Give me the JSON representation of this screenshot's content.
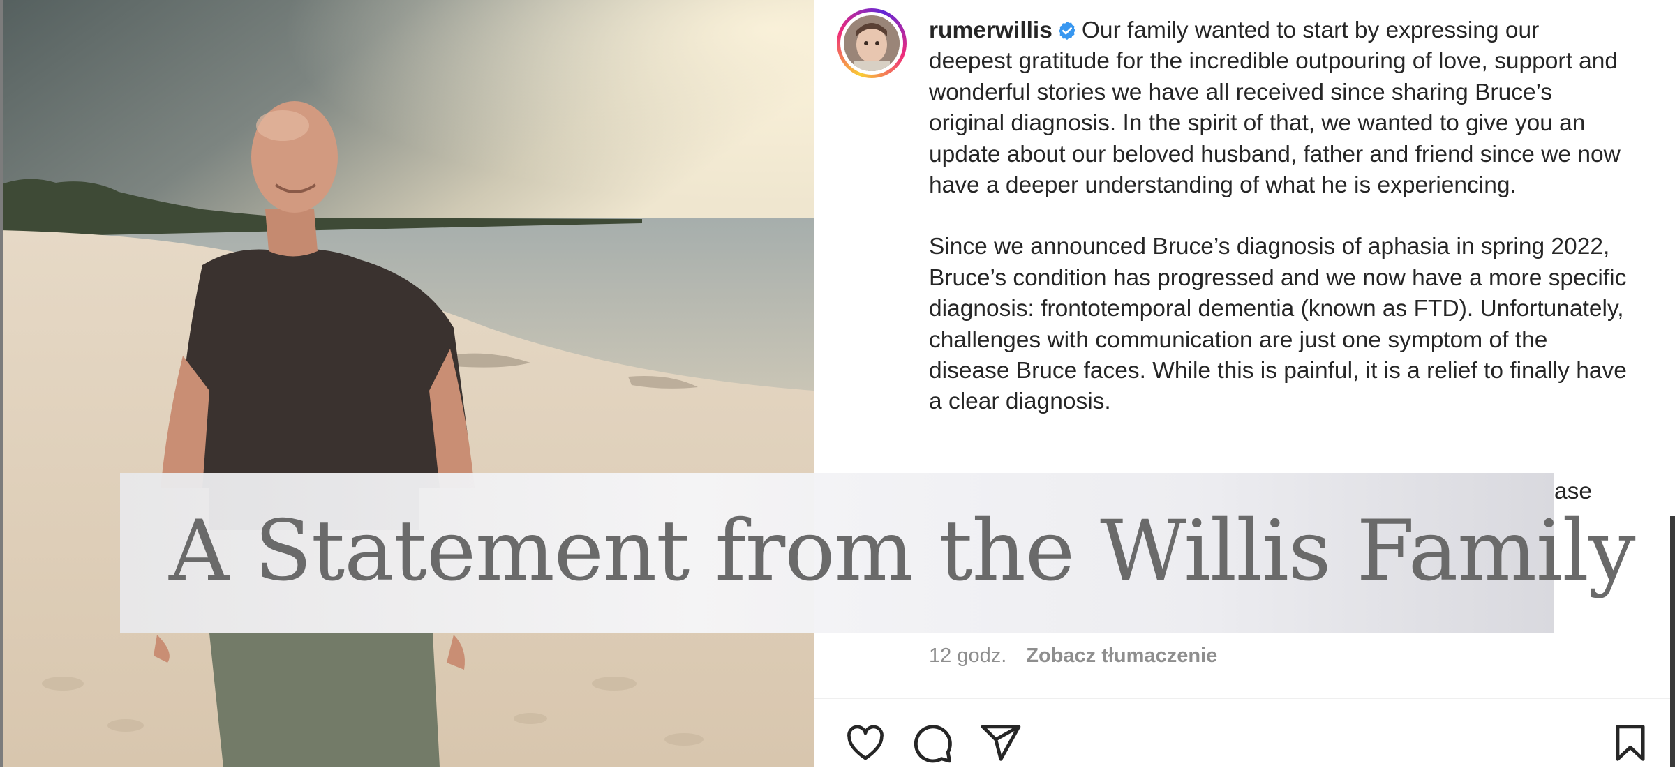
{
  "post": {
    "username": "rumerwillis",
    "caption_paragraphs": [
      "Our family wanted to start by expressing our deepest gratitude for the incredible outpouring of love, support and wonderful stories we have all received since sharing Bruce’s original diagnosis. In the spirit of that, we wanted to give you an update about our beloved husband, father and friend since we now have a deeper understanding of what he is experiencing.",
      "Since we announced Bruce’s diagnosis of aphasia in spring 2022, Bruce’s condition has progressed and we now have a more specific diagnosis: frontotemporal dementia (known as FTD). Unfortunately, challenges with communication are just one symptom of the disease Bruce faces. While this is painful, it is a relief to finally have a clear diagnosis."
    ],
    "partial_text": "ase",
    "timestamp": "12 godz.",
    "translate_label": "Zobacz tłumaczenie"
  },
  "banner": {
    "title": "A Statement from the Willis Family"
  },
  "icons": {
    "verified": "verified-badge-icon",
    "like": "heart-icon",
    "comment": "comment-icon",
    "share": "send-icon",
    "save": "bookmark-icon"
  },
  "colors": {
    "verified_blue": "#3897f0",
    "text": "#262626",
    "muted": "#8e8e8e"
  }
}
